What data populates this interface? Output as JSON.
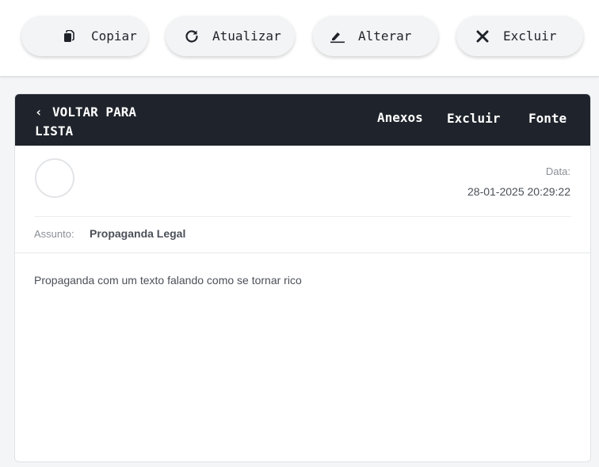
{
  "toolbar": {
    "copy": {
      "label": "Copiar",
      "icon": "copy-icon"
    },
    "refresh": {
      "label": "Atualizar",
      "icon": "refresh-icon"
    },
    "edit": {
      "label": "Alterar",
      "icon": "edit-icon"
    },
    "delete": {
      "label": "Excluir",
      "icon": "close-icon"
    }
  },
  "message": {
    "back_label": "VOLTAR PARA LISTA",
    "header_links": {
      "attachments": "Anexos",
      "delete": "Excluir",
      "source": "Fonte"
    },
    "date_label": "Data:",
    "date_value": "28-01-2025 20:29:22",
    "subject_label": "Assunto:",
    "subject_value": "Propaganda Legal",
    "body": "Propaganda com um texto falando como se tornar rico"
  },
  "colors": {
    "header_bg": "#1f232b",
    "page_bg": "#f4f5f7",
    "button_bg": "#f3f4f6",
    "text_primary": "#1f2329",
    "text_muted": "#8a8f96"
  }
}
